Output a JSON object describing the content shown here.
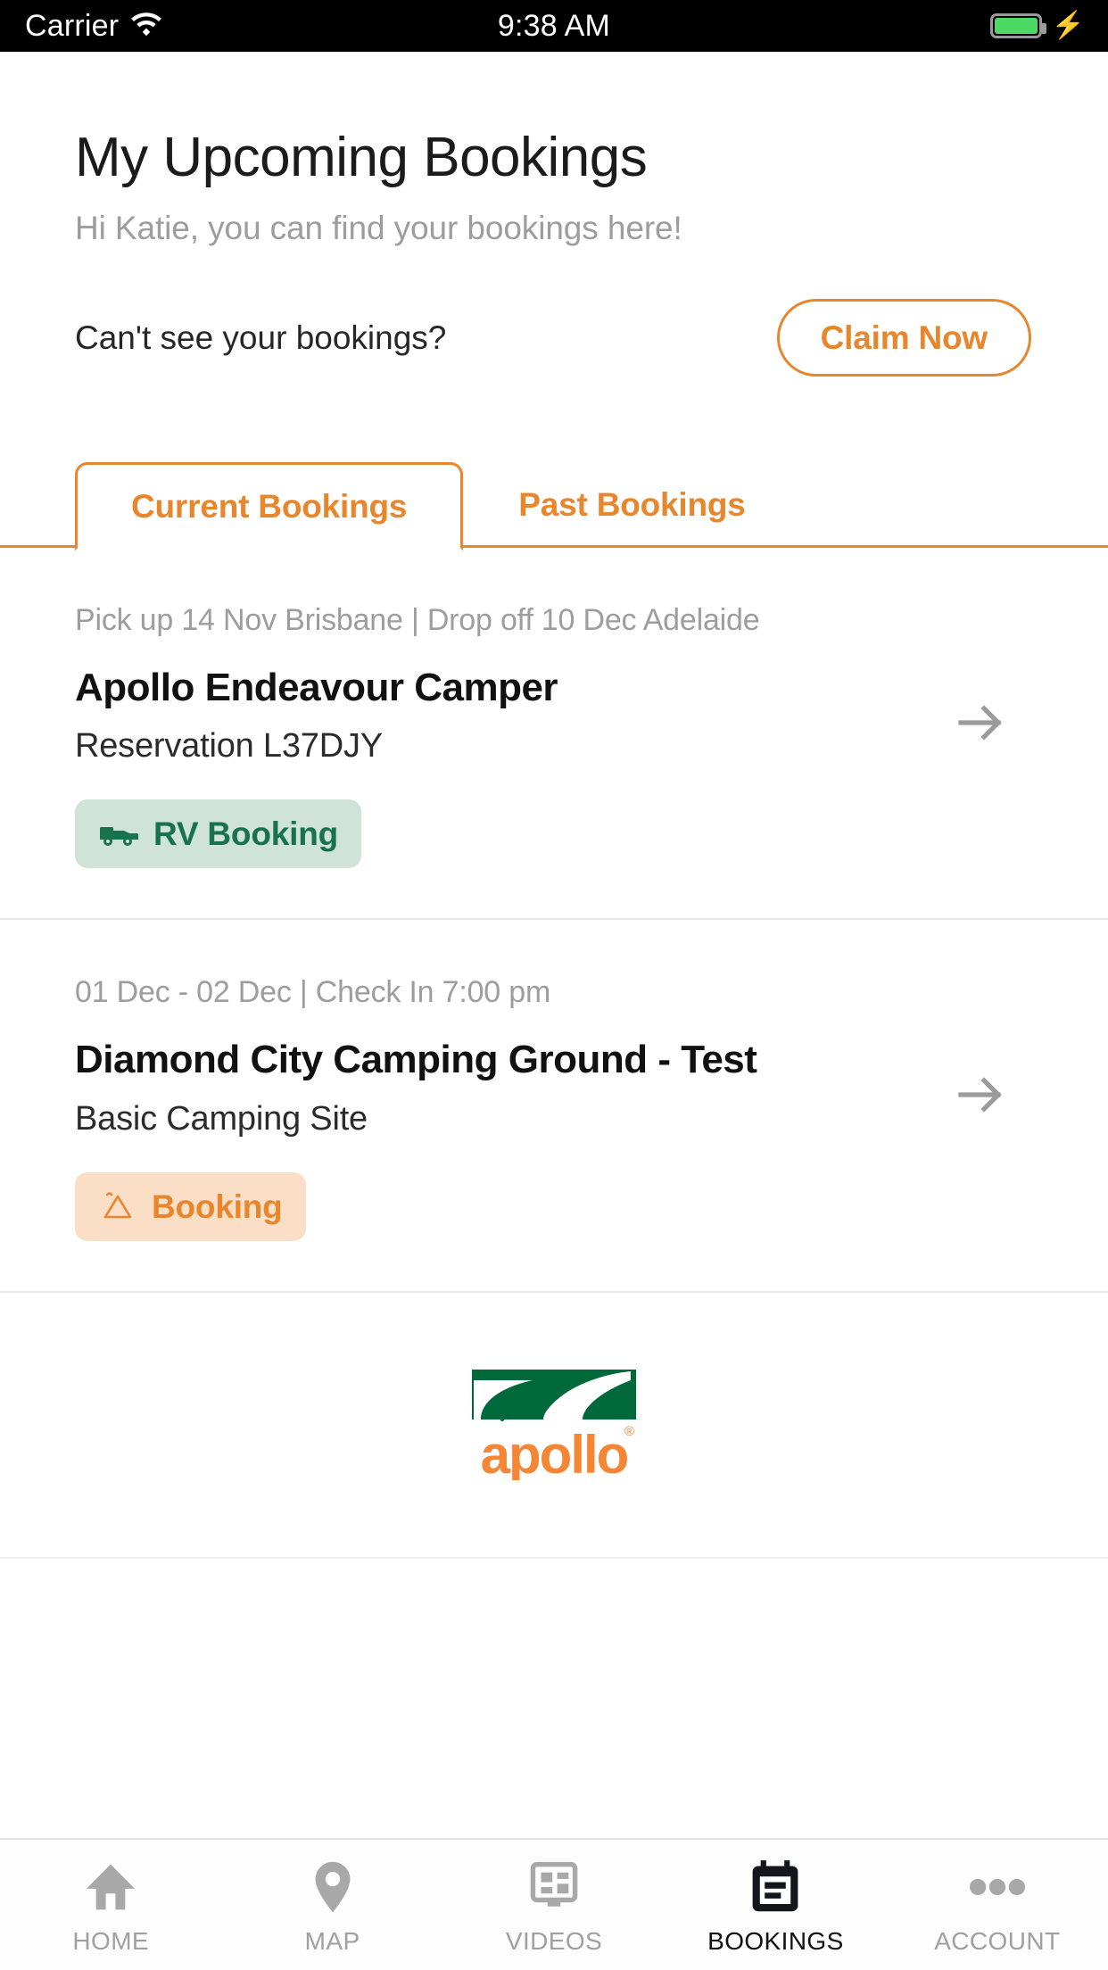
{
  "status_bar": {
    "carrier": "Carrier",
    "wifi_icon": "wifi-icon",
    "time": "9:38 AM",
    "battery_icon": "battery-icon",
    "charging_icon": "lightning-bolt-icon"
  },
  "header": {
    "title": "My Upcoming Bookings",
    "subtitle": "Hi Katie, you can find your bookings here!"
  },
  "claim": {
    "prompt": "Can't see your bookings?",
    "button_label": "Claim Now"
  },
  "tabs": [
    {
      "label": "Current Bookings",
      "active": true
    },
    {
      "label": "Past Bookings",
      "active": false
    }
  ],
  "bookings": [
    {
      "meta": "Pick up 14 Nov Brisbane | Drop off 10 Dec Adelaide",
      "title": "Apollo Endeavour Camper",
      "subtitle": "Reservation L37DJY",
      "badge_label": "RV Booking",
      "badge_icon": "rv-van-icon",
      "arrow_icon": "arrow-right-icon"
    },
    {
      "meta": "01 Dec - 02 Dec | Check In 7:00 pm",
      "title": "Diamond City Camping Ground - Test",
      "subtitle": "Basic Camping Site",
      "badge_label": "Booking",
      "badge_icon": "tent-icon",
      "arrow_icon": "arrow-right-icon"
    }
  ],
  "logo": {
    "name": "apollo-logo",
    "wordmark": "apollo",
    "trademark": "®"
  },
  "bottom_nav": [
    {
      "label": "HOME",
      "icon": "home-icon",
      "active": false
    },
    {
      "label": "MAP",
      "icon": "map-pin-icon",
      "active": false
    },
    {
      "label": "VIDEOS",
      "icon": "videos-icon",
      "active": false
    },
    {
      "label": "BOOKINGS",
      "icon": "calendar-icon",
      "active": true
    },
    {
      "label": "ACCOUNT",
      "icon": "more-dots-icon",
      "active": false
    }
  ],
  "colors": {
    "accent_orange": "#E8862E",
    "badge_green_bg": "#cfe3d9",
    "badge_green_fg": "#17724d",
    "badge_orange_bg": "#fadfc6",
    "logo_green": "#00693C",
    "logo_orange": "#F58634",
    "muted_gray": "#9d9d9d"
  }
}
